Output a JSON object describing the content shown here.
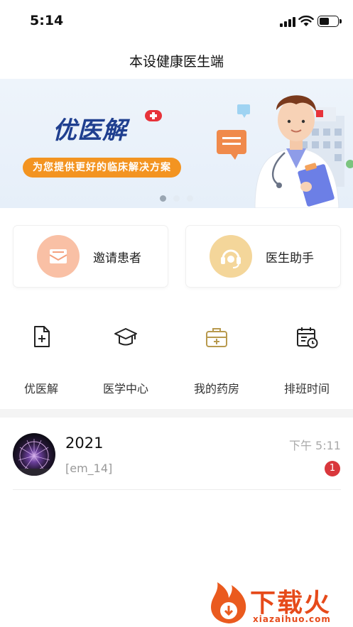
{
  "status_bar": {
    "time": "5:14"
  },
  "nav": {
    "title": "本设健康医生端"
  },
  "banner": {
    "brand": "优医解",
    "slogan": "为您提供更好的临床解决方案",
    "accent": "#f39421",
    "brand_color": "#1f3f8f"
  },
  "quick_actions": [
    {
      "label": "邀请患者",
      "icon": "mail-icon",
      "color": "#f9c0a5"
    },
    {
      "label": "医生助手",
      "icon": "headset-icon",
      "color": "#f4d69a"
    }
  ],
  "menu": [
    {
      "label": "优医解",
      "icon": "document-add-icon"
    },
    {
      "label": "医学中心",
      "icon": "graduation-cap-icon"
    },
    {
      "label": "我的药房",
      "icon": "medical-kit-icon"
    },
    {
      "label": "排班时间",
      "icon": "calendar-clock-icon"
    }
  ],
  "messages": [
    {
      "name": "2021",
      "preview": "[em_14]",
      "time": "下午 5:11",
      "unread": "1"
    }
  ],
  "watermark": {
    "text": "下载火",
    "domain": "xiazaihuo.com"
  }
}
